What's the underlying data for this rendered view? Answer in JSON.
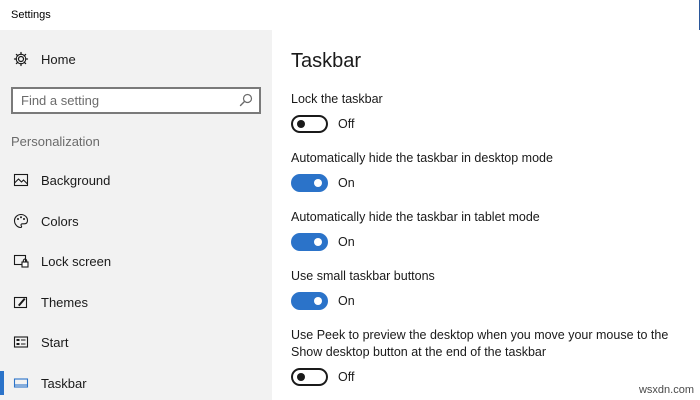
{
  "window": {
    "title": "Settings"
  },
  "sidebar": {
    "home_label": "Home",
    "search": {
      "placeholder": "Find a setting",
      "value": ""
    },
    "section_header": "Personalization",
    "items": [
      {
        "label": "Background",
        "icon": "picture-icon"
      },
      {
        "label": "Colors",
        "icon": "palette-icon"
      },
      {
        "label": "Lock screen",
        "icon": "lock-screen-icon"
      },
      {
        "label": "Themes",
        "icon": "brush-icon"
      },
      {
        "label": "Start",
        "icon": "start-menu-icon"
      },
      {
        "label": "Taskbar",
        "icon": "taskbar-icon",
        "active": true
      }
    ]
  },
  "main": {
    "title": "Taskbar",
    "settings": [
      {
        "label": "Lock the taskbar",
        "state": "Off",
        "on": false
      },
      {
        "label": "Automatically hide the taskbar in desktop mode",
        "state": "On",
        "on": true
      },
      {
        "label": "Automatically hide the taskbar in tablet mode",
        "state": "On",
        "on": true
      },
      {
        "label": "Use small taskbar buttons",
        "state": "On",
        "on": true
      },
      {
        "label": "Use Peek to preview the desktop when you move your mouse to the Show desktop button at the end of the taskbar",
        "state": "Off",
        "on": false
      }
    ]
  },
  "watermark": "wsxdn.com",
  "colors": {
    "accent": "#2b73c9",
    "sidebar_bg": "#f2f2f2"
  }
}
